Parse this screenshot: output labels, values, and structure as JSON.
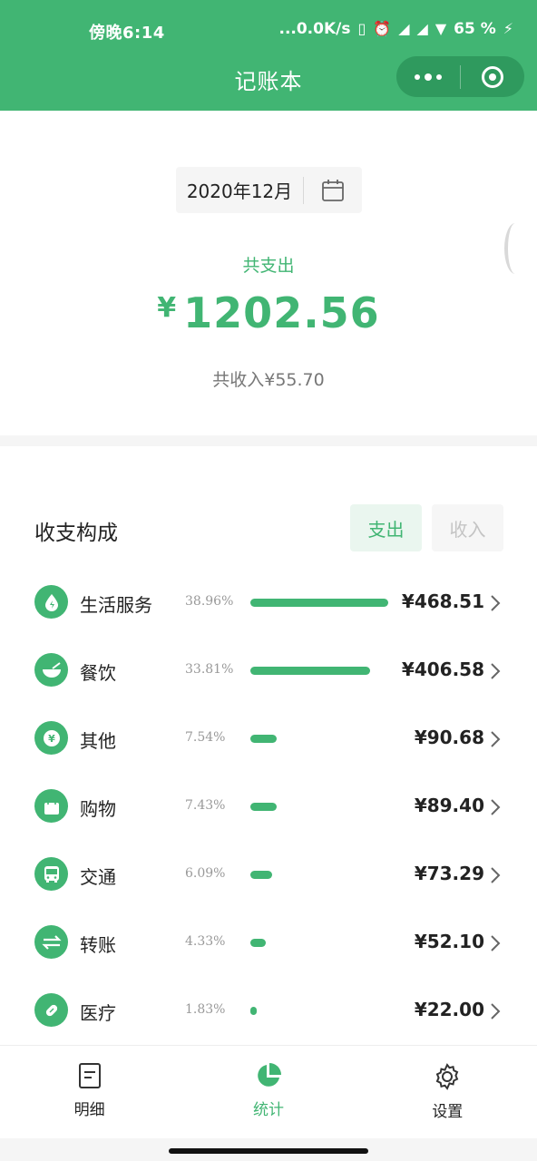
{
  "status_bar": {
    "time": "傍晚6:14",
    "network_speed": "...0.0K/s",
    "battery": "65 %"
  },
  "header": {
    "title": "记账本"
  },
  "summary": {
    "month": "2020年12月",
    "expense_label": "共支出",
    "currency": "¥",
    "expense_total": "1202.56",
    "income_text": "共收入¥55.70"
  },
  "composition": {
    "title": "收支构成",
    "toggle_expense": "支出",
    "toggle_income": "收入",
    "categories": [
      {
        "name": "生活服务",
        "percent": "38.96%",
        "share": 38.96,
        "amount": "¥468.51",
        "icon": "water-drop-icon"
      },
      {
        "name": "餐饮",
        "percent": "33.81%",
        "share": 33.81,
        "amount": "¥406.58",
        "icon": "bowl-icon"
      },
      {
        "name": "其他",
        "percent": "7.54%",
        "share": 7.54,
        "amount": "¥90.68",
        "icon": "yen-coin-icon"
      },
      {
        "name": "购物",
        "percent": "7.43%",
        "share": 7.43,
        "amount": "¥89.40",
        "icon": "shopping-bag-icon"
      },
      {
        "name": "交通",
        "percent": "6.09%",
        "share": 6.09,
        "amount": "¥73.29",
        "icon": "bus-icon"
      },
      {
        "name": "转账",
        "percent": "4.33%",
        "share": 4.33,
        "amount": "¥52.10",
        "icon": "transfer-arrows-icon"
      },
      {
        "name": "医疗",
        "percent": "1.83%",
        "share": 1.83,
        "amount": "¥22.00",
        "icon": "pill-icon"
      }
    ]
  },
  "tabbar": {
    "items": [
      {
        "label": "明细",
        "icon": "document-icon",
        "active": false
      },
      {
        "label": "统计",
        "icon": "pie-chart-icon",
        "active": true
      },
      {
        "label": "设置",
        "icon": "gear-icon",
        "active": false
      }
    ]
  },
  "colors": {
    "brand": "#41b573",
    "capsule": "#2f9a5e"
  }
}
